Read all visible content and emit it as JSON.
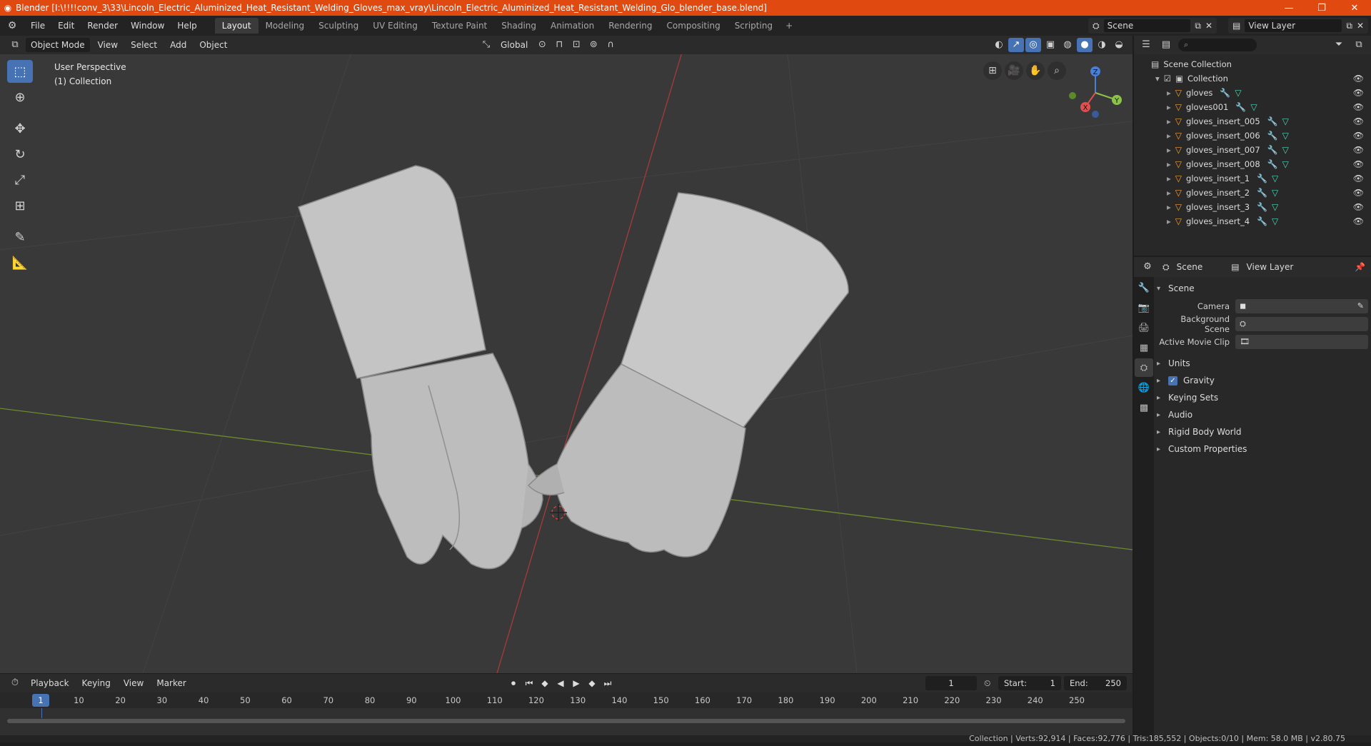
{
  "window": {
    "title": "Blender [I:\\!!!!conv_3\\33\\Lincoln_Electric_Aluminized_Heat_Resistant_Welding_Gloves_max_vray\\Lincoln_Electric_Aluminized_Heat_Resistant_Welding_Glo_blender_base.blend]",
    "minimize": "—",
    "restore": "❐",
    "close": "✕",
    "accent_color": "#e04a10"
  },
  "menu": {
    "items": [
      "File",
      "Edit",
      "Render",
      "Window",
      "Help"
    ]
  },
  "workspaces": {
    "tabs": [
      "Layout",
      "Modeling",
      "Sculpting",
      "UV Editing",
      "Texture Paint",
      "Shading",
      "Animation",
      "Rendering",
      "Compositing",
      "Scripting"
    ],
    "active": "Layout",
    "add": "+"
  },
  "scene_selector": {
    "value": "Scene"
  },
  "viewlayer_selector": {
    "value": "View Layer"
  },
  "viewport": {
    "mode": "Object Mode",
    "menus": [
      "View",
      "Select",
      "Add",
      "Object"
    ],
    "transform_orientation": "Global",
    "info_line1": "User Perspective",
    "info_line2": "(1) Collection"
  },
  "outliner": {
    "root": "Scene Collection",
    "collection": "Collection",
    "objects": [
      "gloves",
      "gloves001",
      "gloves_insert_005",
      "gloves_insert_006",
      "gloves_insert_007",
      "gloves_insert_008",
      "gloves_insert_1",
      "gloves_insert_2",
      "gloves_insert_3",
      "gloves_insert_4"
    ]
  },
  "properties": {
    "tab_scene": "Scene",
    "tab_viewlayer": "View Layer",
    "section": "Scene",
    "camera_label": "Camera",
    "background_scene_label": "Background Scene",
    "movie_clip_label": "Active Movie Clip",
    "panels": [
      "Units",
      "Gravity",
      "Keying Sets",
      "Audio",
      "Rigid Body World",
      "Custom Properties"
    ],
    "gravity_checked": true
  },
  "timeline": {
    "menus": [
      "Playback",
      "Keying",
      "View",
      "Marker"
    ],
    "current_frame": "1",
    "start_label": "Start:",
    "start": "1",
    "end_label": "End:",
    "end": "250",
    "ticks": [
      "10",
      "20",
      "30",
      "40",
      "50",
      "60",
      "70",
      "80",
      "90",
      "100",
      "110",
      "120",
      "130",
      "140",
      "150",
      "160",
      "170",
      "180",
      "190",
      "200",
      "210",
      "220",
      "230",
      "240",
      "250"
    ]
  },
  "status": {
    "text": "Collection | Verts:92,914 | Faces:92,776 | Tris:185,552 | Objects:0/10 | Mem: 58.0 MB | v2.80.75"
  }
}
